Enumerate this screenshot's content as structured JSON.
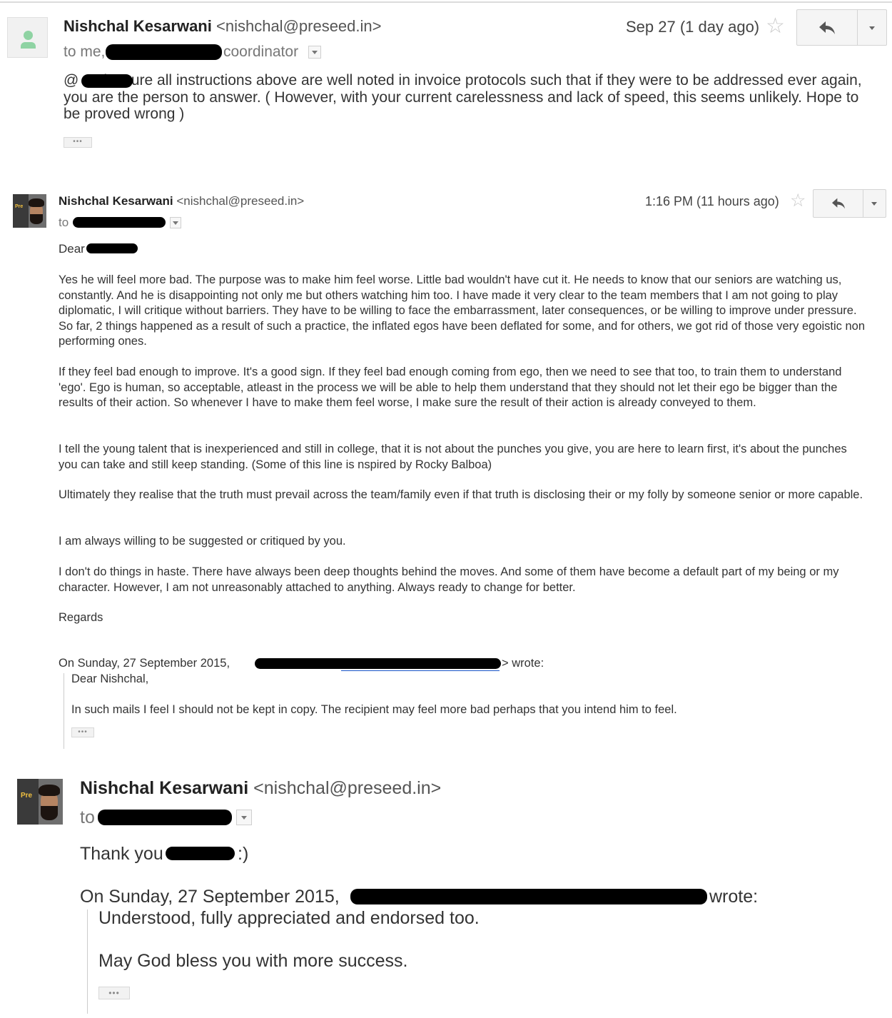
{
  "messages": [
    {
      "sender_name": "Nishchal Kesarwani",
      "sender_email": "<nishchal@preseed.in>",
      "to_prefix": "to me,",
      "to_suffix": "coordinator",
      "date": "Sep 27 (1 day ago)",
      "reply_icon": "reply-arrow-icon",
      "body": [
        "@        make sure all instructions above are well noted in invoice protocols such that if they were to be addressed ever again, you are the person to answer. ( However, with your current carelessness and lack of speed, this seems unlikely. Hope to be proved wrong )"
      ],
      "ellipsis": "•••"
    },
    {
      "sender_name": "Nishchal Kesarwani",
      "sender_email": "<nishchal@preseed.in>",
      "to_prefix": "to",
      "date": "1:16 PM (11 hours ago)",
      "reply_icon": "reply-arrow-icon",
      "greeting": "Dear",
      "body": [
        "Yes he will feel more bad. The purpose was to make him feel worse. Little bad wouldn't have cut it. He needs to know that our seniors are watching us, constantly. And he is disappointing not only me but others watching him too. I have made it very clear to the team members that I am not going to play diplomatic, I will critique without barriers. They have to be willing to face the embarrassment, later consequences, or be willing to improve under pressure. So far, 2 things happened as a result of such a practice, the inflated egos have been deflated for some, and for others, we got rid of those very egoistic non performing ones.",
        "If they feel bad enough to improve. It's a good sign. If they feel bad enough coming from ego, then we need to see that too, to train them to understand 'ego'. Ego is human, so acceptable, atleast in the process we will be able to help them understand that they should not let their ego be bigger than the results of their action. So whenever I have to make them feel worse, I make sure the result of their action is already conveyed to them.",
        "I tell the young talent that is inexperienced and still in college, that it is not about the punches you give, you are here to learn first, it's about the punches you can take and still keep standing. (Some of this line is nspired by Rocky Balboa)",
        "Ultimately they realise that the truth must prevail across the team/family even if that truth is disclosing their or my folly by someone senior or more capable.",
        "I am always willing to be suggested or critiqued by you.",
        "I don't do things in haste. There have always been deep thoughts behind the moves. And some of them have become a default part of my being or my character. However, I am not unreasonably attached to anything. Always ready to change for better.",
        "Regards"
      ],
      "quote_header_prefix": "On Sunday, 27 September 2015,",
      "quote_header_suffix": "> wrote:",
      "quote": [
        "Dear Nishchal,",
        "In such mails I feel I should not be kept in copy. The recipient may feel more bad perhaps that you intend him to feel."
      ],
      "ellipsis": "•••"
    },
    {
      "sender_name": "Nishchal Kesarwani",
      "sender_email": "<nishchal@preseed.in>",
      "to_prefix": "to",
      "thanks_prefix": "Thank you",
      "thanks_suffix": ":)",
      "quote_header_prefix": "On Sunday, 27 September 2015,",
      "quote_header_suffix": "wrote:",
      "quote": [
        "Understood, fully appreciated and endorsed too.",
        "May God bless you with more success."
      ],
      "ellipsis": "•••"
    }
  ],
  "avatar_sign_text": "Pre"
}
